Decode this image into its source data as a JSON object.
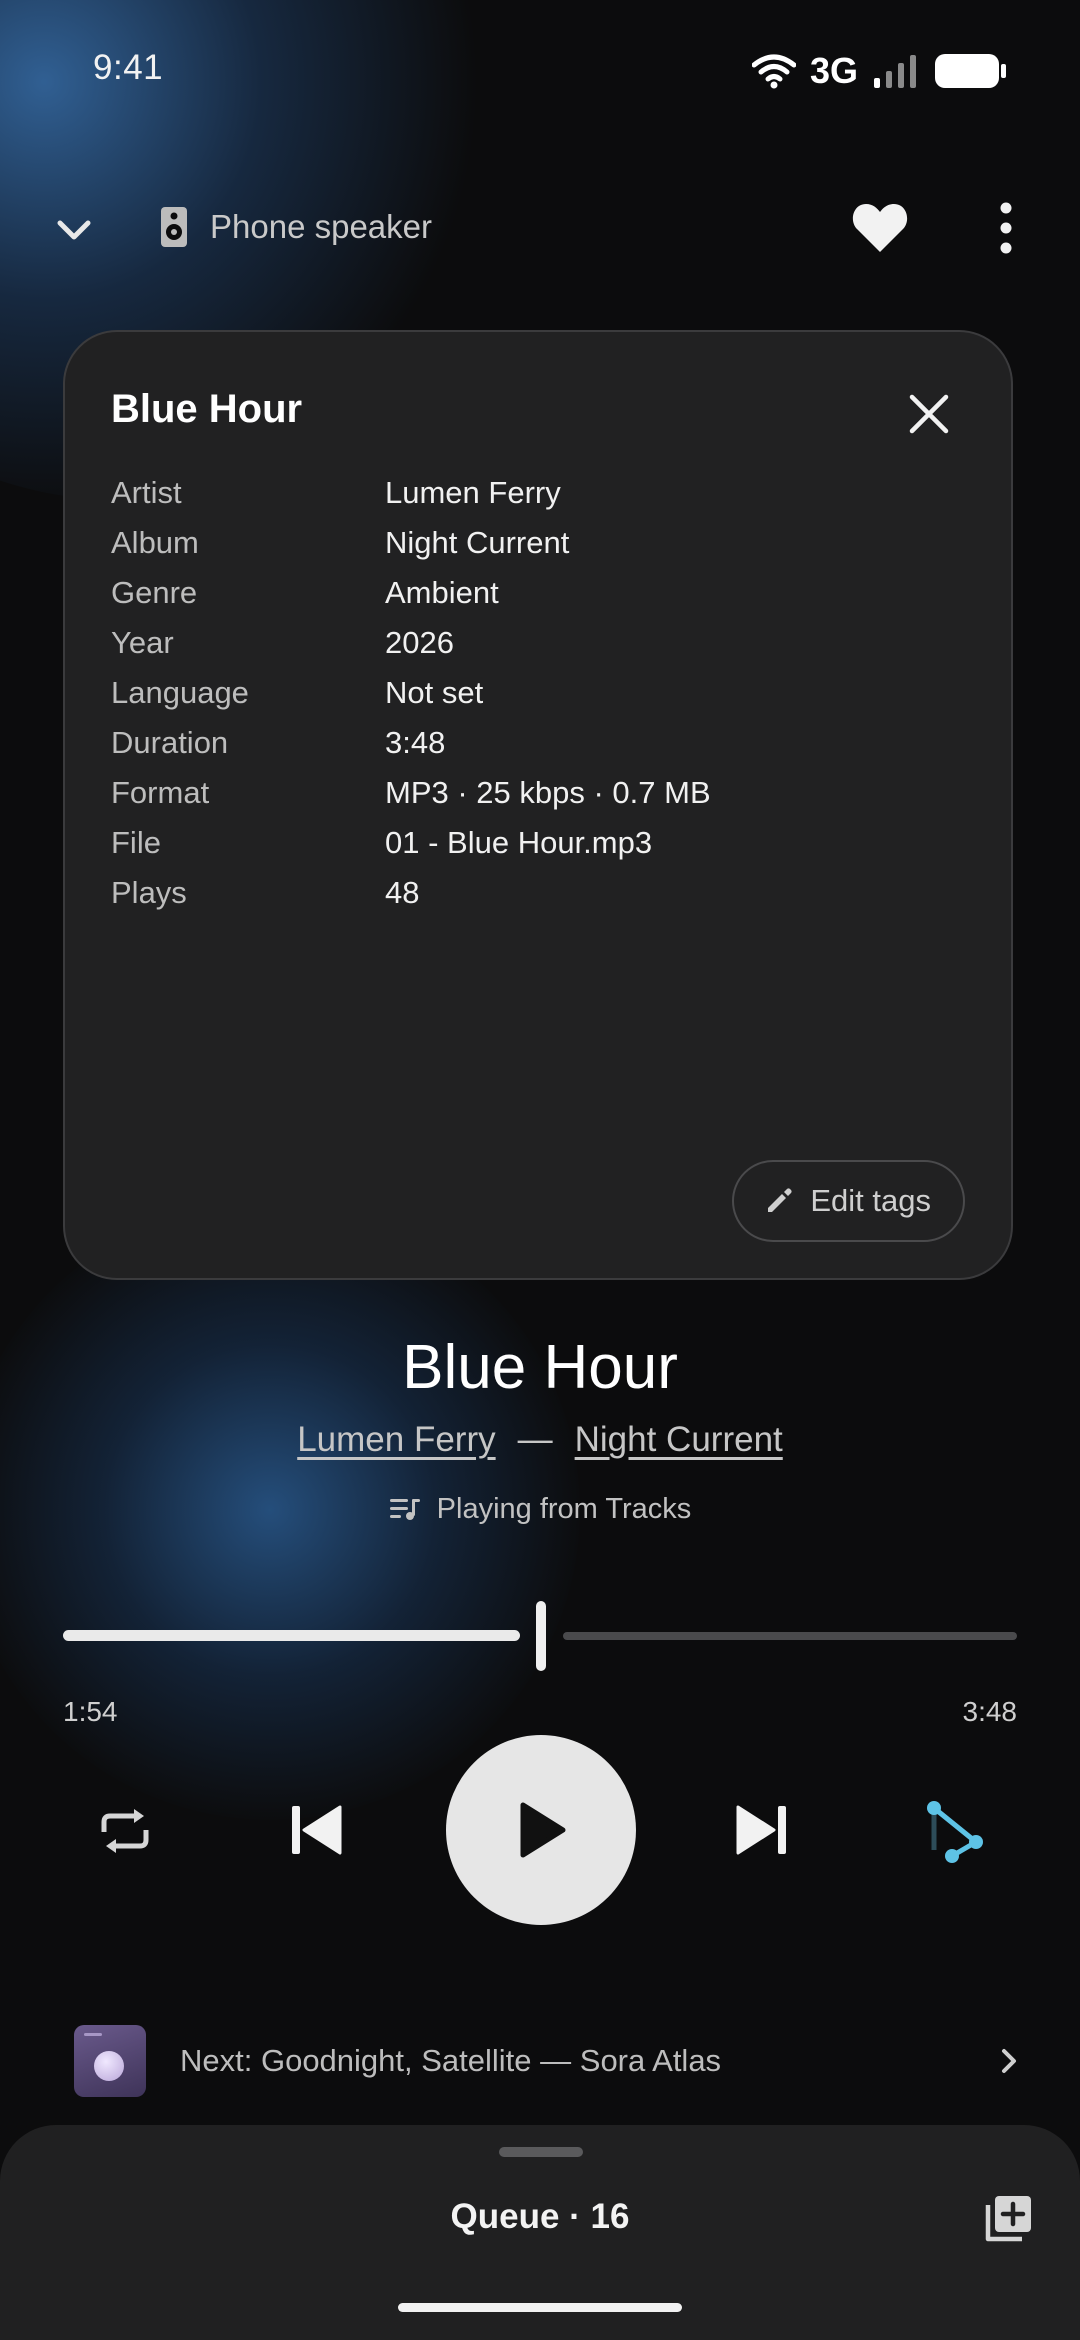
{
  "status_bar": {
    "time": "9:41",
    "network": "3G"
  },
  "top_bar": {
    "output_device": "Phone speaker",
    "icons": [
      "chevron-down-icon",
      "speaker-icon",
      "heart-icon",
      "more-vertical-icon"
    ]
  },
  "info_card": {
    "title": "Blue Hour",
    "rows": [
      {
        "key": "Artist",
        "value": "Lumen Ferry"
      },
      {
        "key": "Album",
        "value": "Night Current"
      },
      {
        "key": "Genre",
        "value": "Ambient"
      },
      {
        "key": "Year",
        "value": "2026"
      },
      {
        "key": "Language",
        "value": "Not set"
      },
      {
        "key": "Duration",
        "value": "3:48"
      },
      {
        "key": "Format",
        "value": "MP3 · 25 kbps · 0.7 MB"
      },
      {
        "key": "File",
        "value": "01 - Blue Hour.mp3"
      },
      {
        "key": "Plays",
        "value": "48"
      }
    ],
    "edit_label": "Edit tags"
  },
  "now_playing": {
    "title": "Blue Hour",
    "artist": "Lumen Ferry",
    "separator": "—",
    "album": "Night Current",
    "source": "Playing from Tracks",
    "elapsed": "1:54",
    "total": "3:48",
    "progress_fraction": 0.5
  },
  "controls": {
    "icons": [
      "repeat-icon",
      "previous-icon",
      "play-icon",
      "next-icon",
      "shuffle-icon"
    ],
    "accent": "#5ec3e6"
  },
  "next_up": {
    "text": "Next: Goodnight, Satellite — Sora Atlas"
  },
  "queue": {
    "label": "Queue · 16"
  }
}
